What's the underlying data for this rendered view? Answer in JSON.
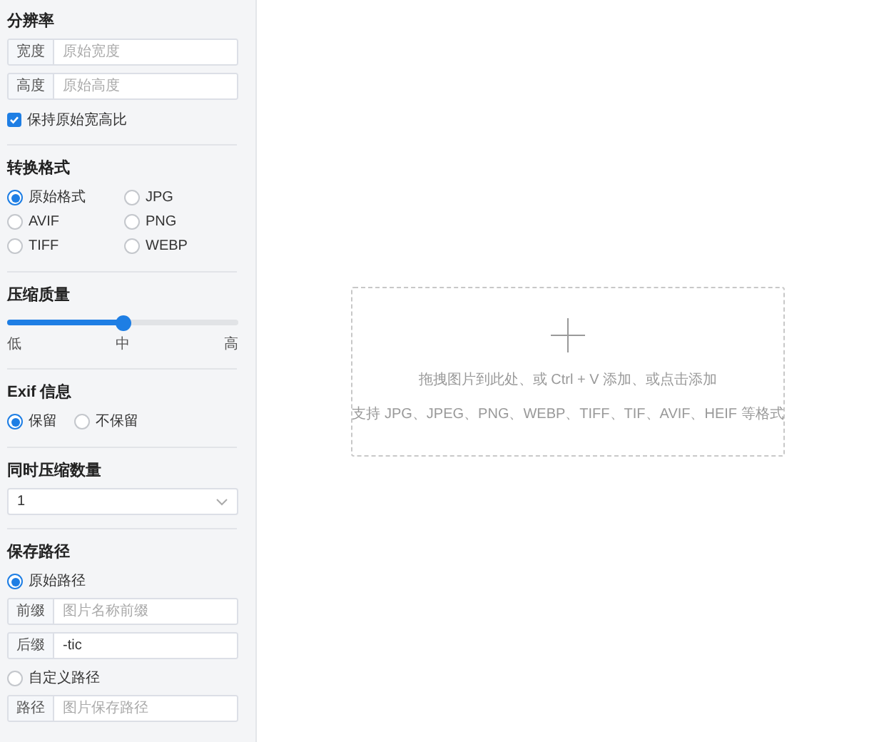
{
  "resolution": {
    "title": "分辨率",
    "fields": [
      {
        "label": "宽度",
        "placeholder": "原始宽度"
      },
      {
        "label": "高度",
        "placeholder": "原始高度"
      }
    ],
    "keep_ratio": {
      "label": "保持原始宽高比",
      "checked": true
    }
  },
  "format": {
    "title": "转换格式",
    "options": [
      {
        "label": "原始格式",
        "selected": true
      },
      {
        "label": "JPG",
        "selected": false
      },
      {
        "label": "AVIF",
        "selected": false
      },
      {
        "label": "PNG",
        "selected": false
      },
      {
        "label": "TIFF",
        "selected": false
      },
      {
        "label": "WEBP",
        "selected": false
      }
    ]
  },
  "quality": {
    "title": "压缩质量",
    "level": 0.5,
    "marks": [
      "低",
      "中",
      "高"
    ]
  },
  "exif": {
    "title": "Exif 信息",
    "options": [
      {
        "label": "保留",
        "selected": true
      },
      {
        "label": "不保留",
        "selected": false
      }
    ]
  },
  "concurrency": {
    "title": "同时压缩数量",
    "value": "1"
  },
  "save_path": {
    "title": "保存路径",
    "original": {
      "label": "原始路径",
      "selected": true
    },
    "fields": [
      {
        "label": "前缀",
        "placeholder": "图片名称前缀"
      },
      {
        "label": "后缀",
        "value": "-tic"
      }
    ],
    "custom": {
      "label": "自定义路径",
      "selected": false
    },
    "path_field": {
      "label": "路径",
      "placeholder": "图片保存路径"
    }
  },
  "dropzone": {
    "hint": "拖拽图片到此处、或 Ctrl + V 添加、或点击添加",
    "formats": "支持 JPG、JPEG、PNG、WEBP、TIFF、TIF、AVIF、HEIF 等格式"
  }
}
